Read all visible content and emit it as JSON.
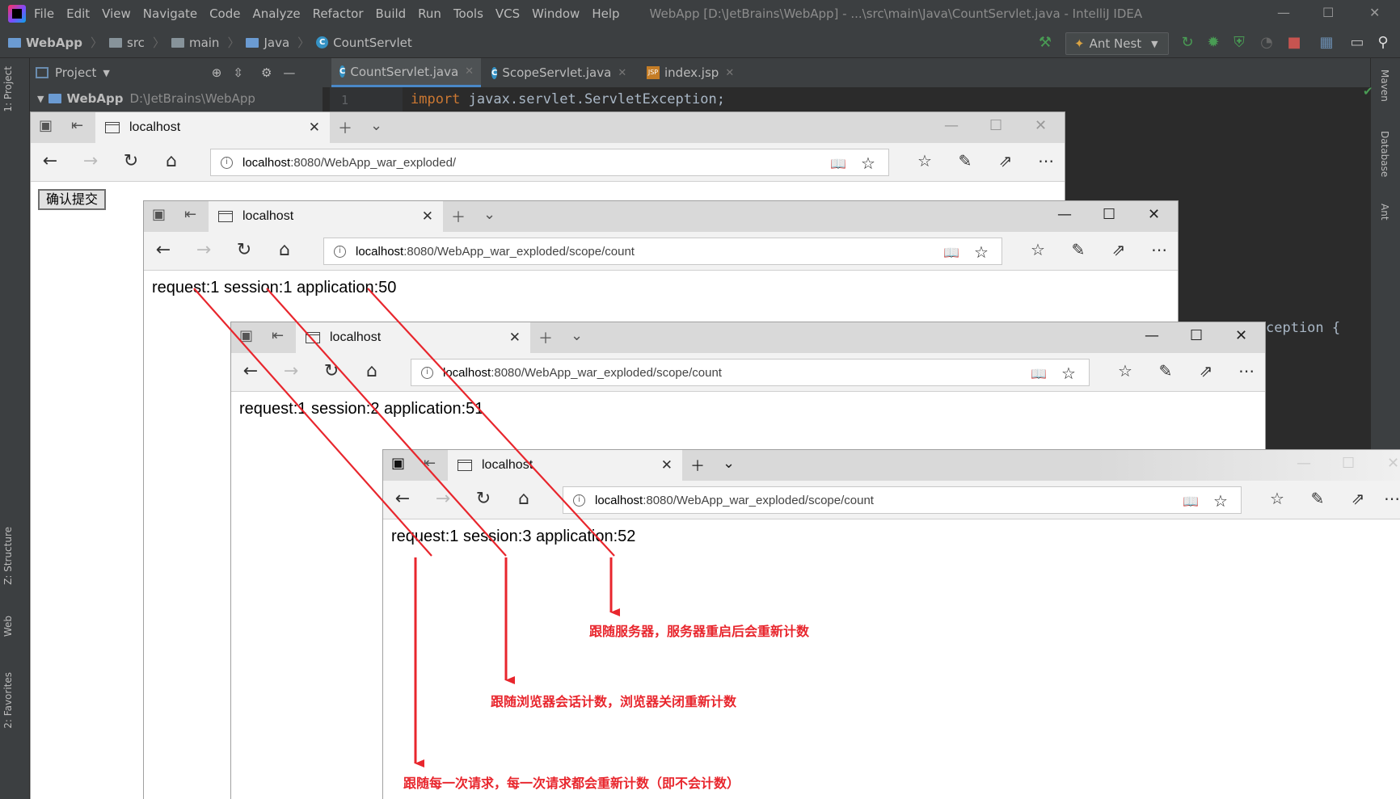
{
  "ide": {
    "menu": [
      "File",
      "Edit",
      "View",
      "Navigate",
      "Code",
      "Analyze",
      "Refactor",
      "Build",
      "Run",
      "Tools",
      "VCS",
      "Window",
      "Help"
    ],
    "title": "WebApp [D:\\JetBrains\\WebApp] - ...\\src\\main\\Java\\CountServlet.java - IntelliJ IDEA",
    "breadcrumbs": [
      "WebApp",
      "src",
      "main",
      "Java",
      "CountServlet"
    ],
    "run_config": "Ant Nest",
    "project_label": "Project",
    "tabs": [
      "CountServlet.java",
      "ScopeServlet.java",
      "index.jsp"
    ],
    "project_root": "WebApp",
    "project_path": "D:\\JetBrains\\WebApp",
    "line_number": "1",
    "code_keyword": "import",
    "code_line1": " javax.servlet.ServletException;",
    "code_fragment": "ception {",
    "left_tools": [
      "1: Project",
      "Z: Structure",
      "Web",
      "2: Favorites"
    ],
    "right_tools": [
      "Maven",
      "Database",
      "Ant"
    ]
  },
  "browsers": [
    {
      "tab_title": "localhost",
      "host": "localhost",
      "path": ":8080/WebApp_war_exploded/",
      "button": "确认提交"
    },
    {
      "tab_title": "localhost",
      "host": "localhost",
      "path": ":8080/WebApp_war_exploded/scope/count",
      "content": "request:1 session:1 application:50"
    },
    {
      "tab_title": "localhost",
      "host": "localhost",
      "path": ":8080/WebApp_war_exploded/scope/count",
      "content": "request:1 session:2 application:51"
    },
    {
      "tab_title": "localhost",
      "host": "localhost",
      "path": ":8080/WebApp_war_exploded/scope/count",
      "content": "request:1 session:3 application:52"
    }
  ],
  "annotations": {
    "application": "跟随服务器，服务器重启后会重新计数",
    "session": "跟随浏览器会话计数，浏览器关闭重新计数",
    "request": "跟随每一次请求，每一次请求都会重新计数（即不会计数）"
  },
  "colors": {
    "annotation": "#e8262d",
    "ide_bg": "#2b2b2b",
    "ide_panel": "#3c3f41"
  }
}
